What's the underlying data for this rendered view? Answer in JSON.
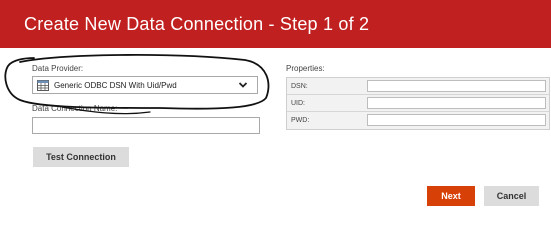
{
  "header": {
    "title": "Create New Data Connection - Step 1 of 2"
  },
  "form": {
    "provider_label": "Data Provider:",
    "provider_selected": "Generic ODBC DSN With Uid/Pwd",
    "provider_icon": "table-icon",
    "connection_name_label": "Data Connection Name:",
    "connection_name_value": "",
    "test_button": "Test Connection"
  },
  "properties": {
    "label": "Properties:",
    "rows": [
      {
        "key": "DSN:",
        "value": ""
      },
      {
        "key": "UID:",
        "value": ""
      },
      {
        "key": "PWD:",
        "value": ""
      }
    ]
  },
  "footer": {
    "next_button": "Next",
    "cancel_button": "Cancel"
  },
  "colors": {
    "header_bg": "#c0201f",
    "next_bg": "#d74108",
    "neutral_button_bg": "#dcdcdc"
  }
}
